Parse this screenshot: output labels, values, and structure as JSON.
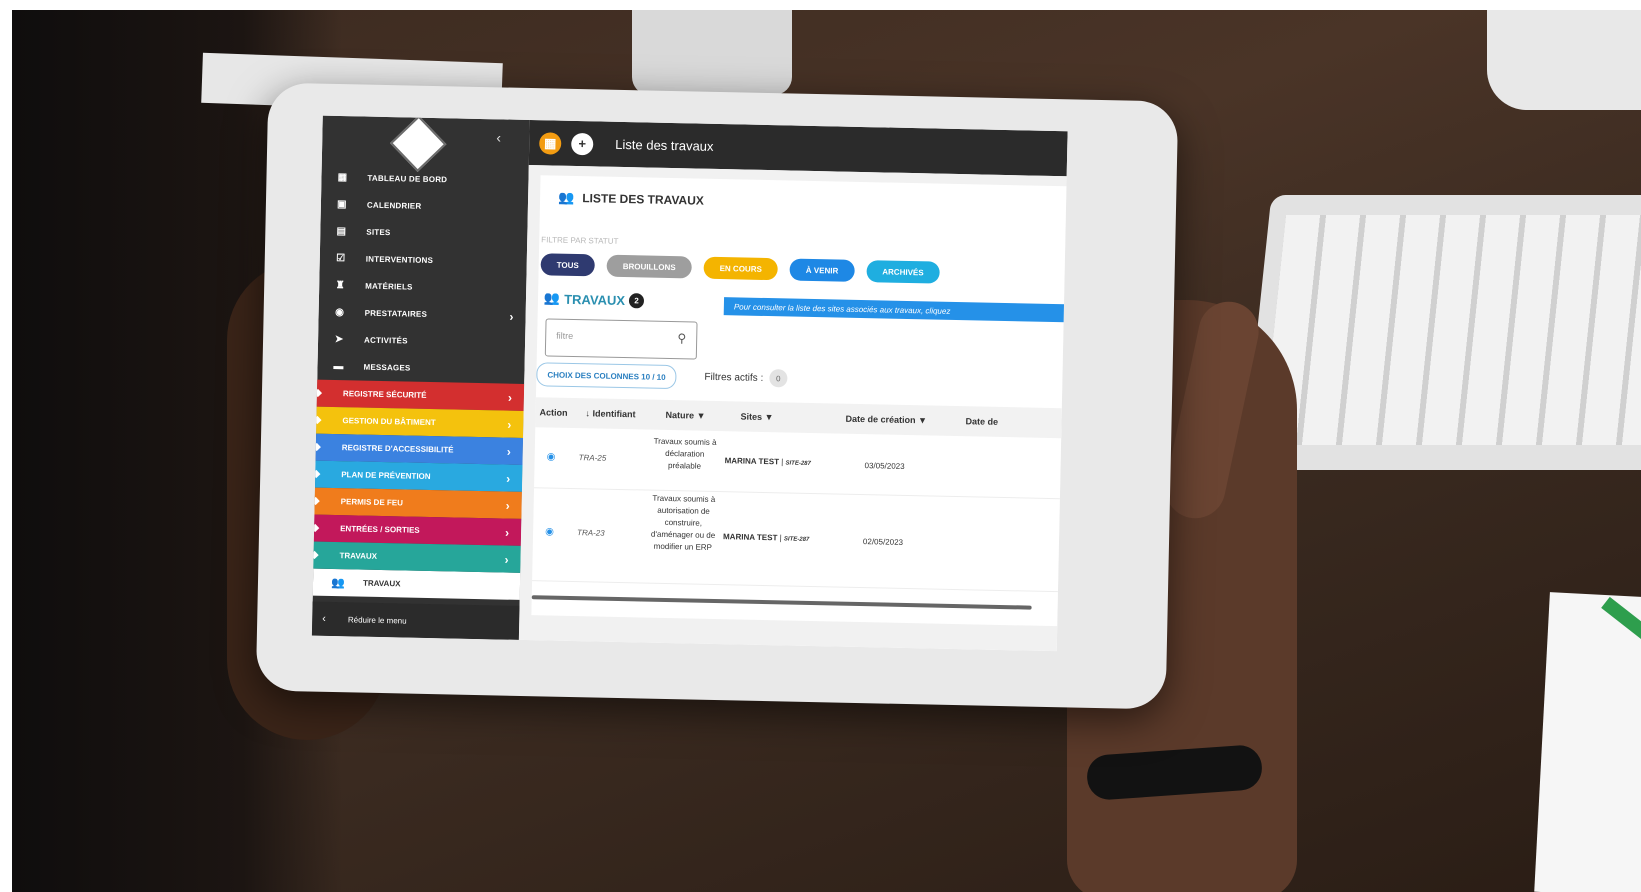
{
  "app": {
    "page_title": "Liste des travaux"
  },
  "sidebar": {
    "items": [
      {
        "label": "TABLEAU DE BORD",
        "icon": "dashboard-icon"
      },
      {
        "label": "CALENDRIER",
        "icon": "calendar-icon"
      },
      {
        "label": "SITES",
        "icon": "building-icon"
      },
      {
        "label": "INTERVENTIONS",
        "icon": "checkbox-icon"
      },
      {
        "label": "MATÉRIELS",
        "icon": "extinguisher-icon"
      },
      {
        "label": "PRESTATAIRES",
        "icon": "user-circle-icon"
      },
      {
        "label": "ACTIVITÉS",
        "icon": "chevron-right-icon"
      },
      {
        "label": "MESSAGES",
        "icon": "message-icon"
      }
    ],
    "modules": [
      {
        "label": "REGISTRE SÉCURITÉ",
        "color": "#d32f2f"
      },
      {
        "label": "GESTION DU BÂTIMENT",
        "color": "#f4c20d"
      },
      {
        "label": "REGISTRE D'ACCESSIBILITÉ",
        "color": "#3b82e0"
      },
      {
        "label": "PLAN DE PRÉVENTION",
        "color": "#29a9e0"
      },
      {
        "label": "PERMIS DE FEU",
        "color": "#f07c1c"
      },
      {
        "label": "ENTRÉES / SORTIES",
        "color": "#c2185b"
      },
      {
        "label": "TRAVAUX",
        "color": "#26a69a"
      }
    ],
    "sub_item": "TRAVAUX",
    "reduce_label": "Réduire le menu"
  },
  "card": {
    "title": "LISTE DES TRAVAUX",
    "filter_label": "FILTRE PAR STATUT",
    "chips": [
      {
        "label": "TOUS",
        "color": "#2f3a70"
      },
      {
        "label": "BROUILLONS",
        "color": "#9e9e9e"
      },
      {
        "label": "EN COURS",
        "color": "#f4b400"
      },
      {
        "label": "À VENIR",
        "color": "#1e88e5"
      },
      {
        "label": "ARCHIVÉS",
        "color": "#1faee0"
      }
    ],
    "section_title": "TRAVAUX",
    "section_count": "2",
    "info_banner": "Pour consulter la liste des sites associés aux travaux, cliquez",
    "search_placeholder": "filtre",
    "columns_button": "CHOIX DES COLONNES 10 / 10",
    "active_filters_label": "Filtres actifs :",
    "active_filters_count": "0"
  },
  "table": {
    "headers": {
      "action": "Action",
      "identifiant": "Identifiant",
      "nature": "Nature",
      "sites": "Sites",
      "date_creation": "Date de création",
      "date_next": "Date de"
    },
    "rows": [
      {
        "id": "TRA-25",
        "nature": "Travaux soumis à déclaration préalable",
        "site": "MARINA TEST",
        "site_code": "SITE-287",
        "date": "03/05/2023"
      },
      {
        "id": "TRA-23",
        "nature": "Travaux soumis à autorisation de construire, d'aménager ou de modifier un ERP",
        "site": "MARINA TEST",
        "site_code": "SITE-287",
        "date": "02/05/2023"
      }
    ]
  }
}
